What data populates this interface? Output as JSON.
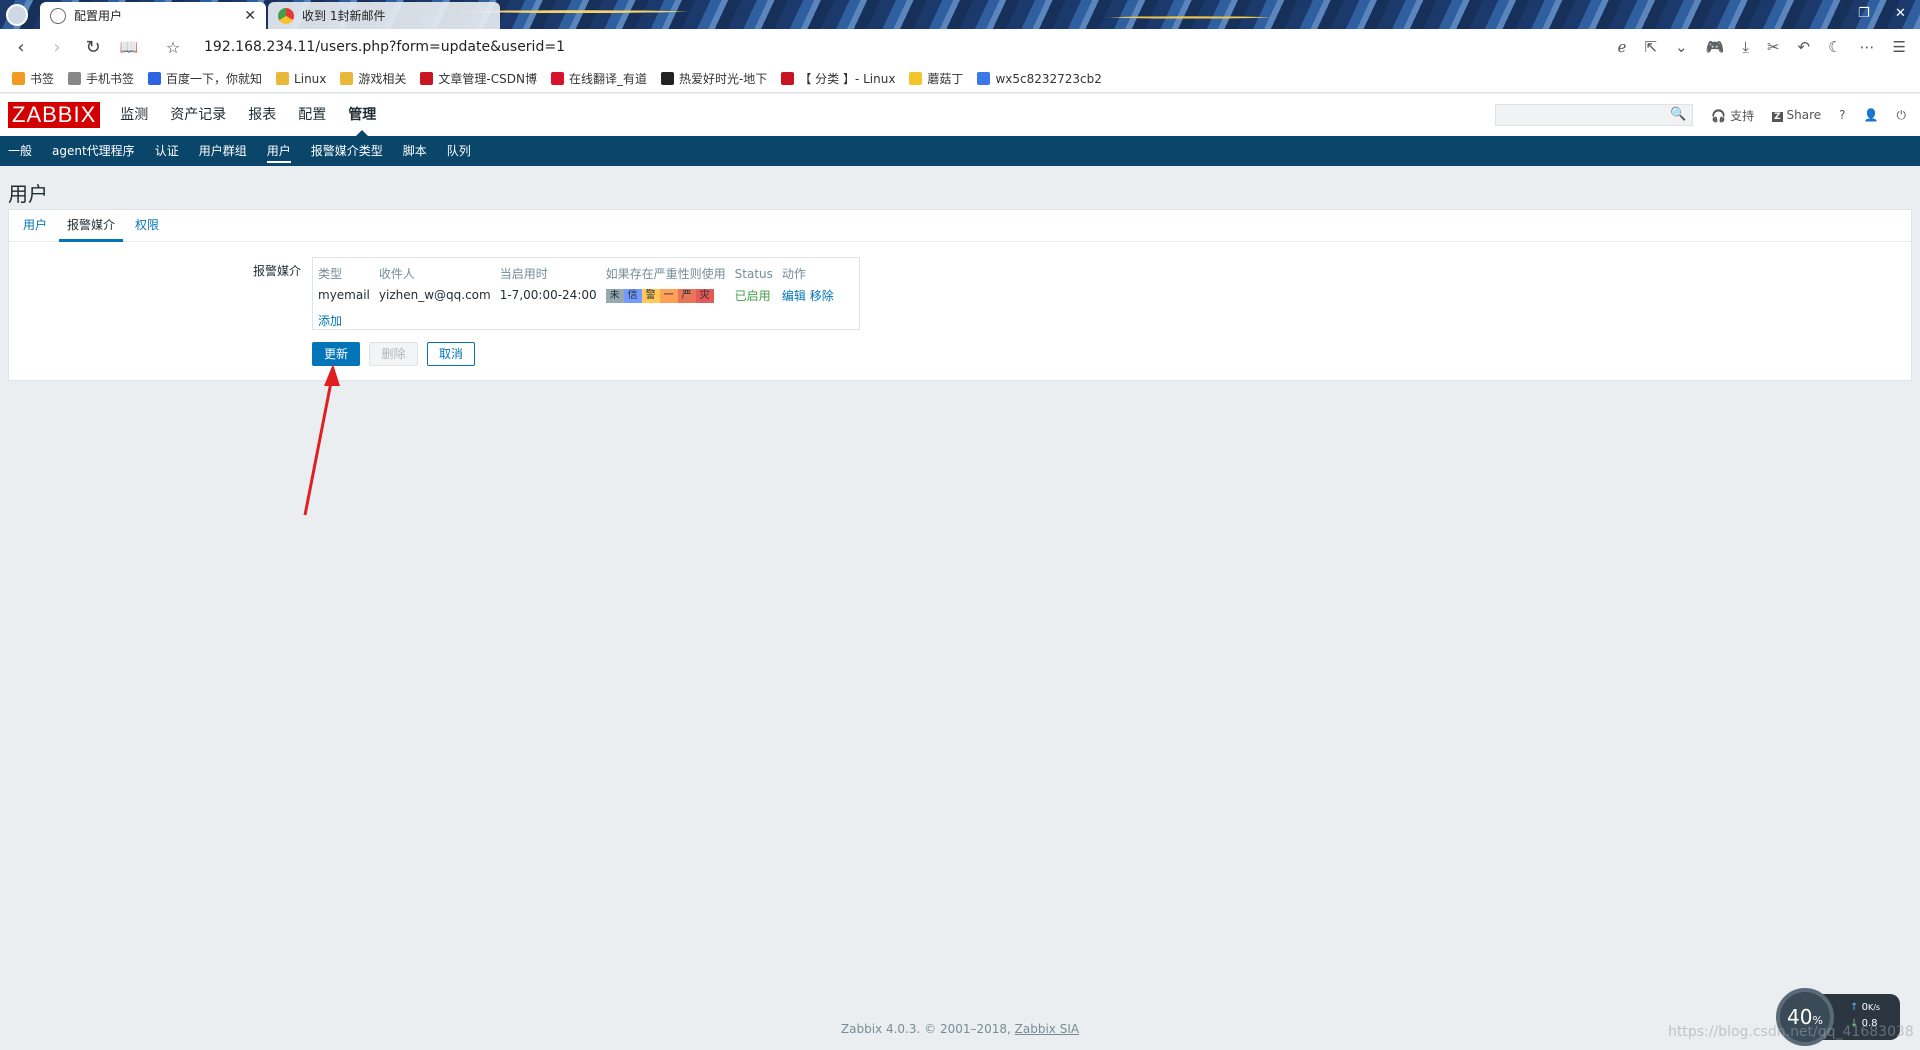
{
  "browser": {
    "tabs": [
      {
        "title": "配置用户",
        "active": true
      },
      {
        "title": "收到 1封新邮件",
        "active": false
      }
    ],
    "url": "192.168.234.11/users.php?form=update&userid=1",
    "bookmarks": [
      {
        "label": "书签",
        "icon": "star-icon",
        "color": "#f29b1f"
      },
      {
        "label": "手机书签",
        "icon": "phone-icon",
        "color": "#888888"
      },
      {
        "label": "百度一下，你就知",
        "icon": "baidu-icon",
        "color": "#2d64e1"
      },
      {
        "label": "Linux",
        "icon": "folder-icon",
        "color": "#e8b83b"
      },
      {
        "label": "游戏相关",
        "icon": "folder-icon",
        "color": "#e8b83b"
      },
      {
        "label": "文章管理-CSDN博",
        "icon": "csdn-icon",
        "color": "#c7161f"
      },
      {
        "label": "在线翻译_有道",
        "icon": "youdao-icon",
        "color": "#d8112a"
      },
      {
        "label": "热爱好时光-地下",
        "icon": "tiger-icon",
        "color": "#222222"
      },
      {
        "label": "【 分类 】- Linux",
        "icon": "csdn-icon",
        "color": "#c7161f"
      },
      {
        "label": "蘑菇丁",
        "icon": "mogu-icon",
        "color": "#f3c52a"
      },
      {
        "label": "wx5c8232723cb2",
        "icon": "blog-icon",
        "color": "#3b78e7"
      }
    ]
  },
  "zabbix": {
    "logo": "ZABBIX",
    "main_menu": [
      "监测",
      "资产记录",
      "报表",
      "配置",
      "管理"
    ],
    "main_menu_selected": "管理",
    "top_right": {
      "support": "支持",
      "share": "Share",
      "help": "?"
    },
    "sub_menu": [
      "一般",
      "agent代理程序",
      "认证",
      "用户群组",
      "用户",
      "报警媒介类型",
      "脚本",
      "队列"
    ],
    "sub_menu_selected": "用户"
  },
  "page": {
    "title": "用户",
    "tabs": [
      "用户",
      "报警媒介",
      "权限"
    ],
    "tab_selected": "报警媒介",
    "form_label": "报警媒介",
    "media_table": {
      "headers": [
        "类型",
        "收件人",
        "当启用时",
        "如果存在严重性则使用",
        "Status",
        "动作"
      ],
      "rows": [
        {
          "type": "myemail",
          "recipient": "yizhen_w@qq.com",
          "when_active": "1-7,00:00-24:00",
          "severities": [
            {
              "label": "未",
              "color": "#97aab3"
            },
            {
              "label": "信",
              "color": "#7499ff"
            },
            {
              "label": "警",
              "color": "#ffc859"
            },
            {
              "label": "一",
              "color": "#ffa059"
            },
            {
              "label": "严",
              "color": "#e97659"
            },
            {
              "label": "灾",
              "color": "#e45959"
            }
          ],
          "status": "已启用",
          "action_edit": "编辑",
          "action_remove": "移除"
        }
      ],
      "add_label": "添加"
    },
    "buttons": {
      "update": "更新",
      "delete": "删除",
      "cancel": "取消"
    }
  },
  "footer": {
    "text": "Zabbix 4.0.3. © 2001–2018, ",
    "link": "Zabbix SIA"
  },
  "net_widget": {
    "percent": "40",
    "percent_unit": "%",
    "up": "0",
    "up_unit": "K/s",
    "down": "0.8"
  },
  "watermark": "https://blog.csdn.net/qq_41683038"
}
